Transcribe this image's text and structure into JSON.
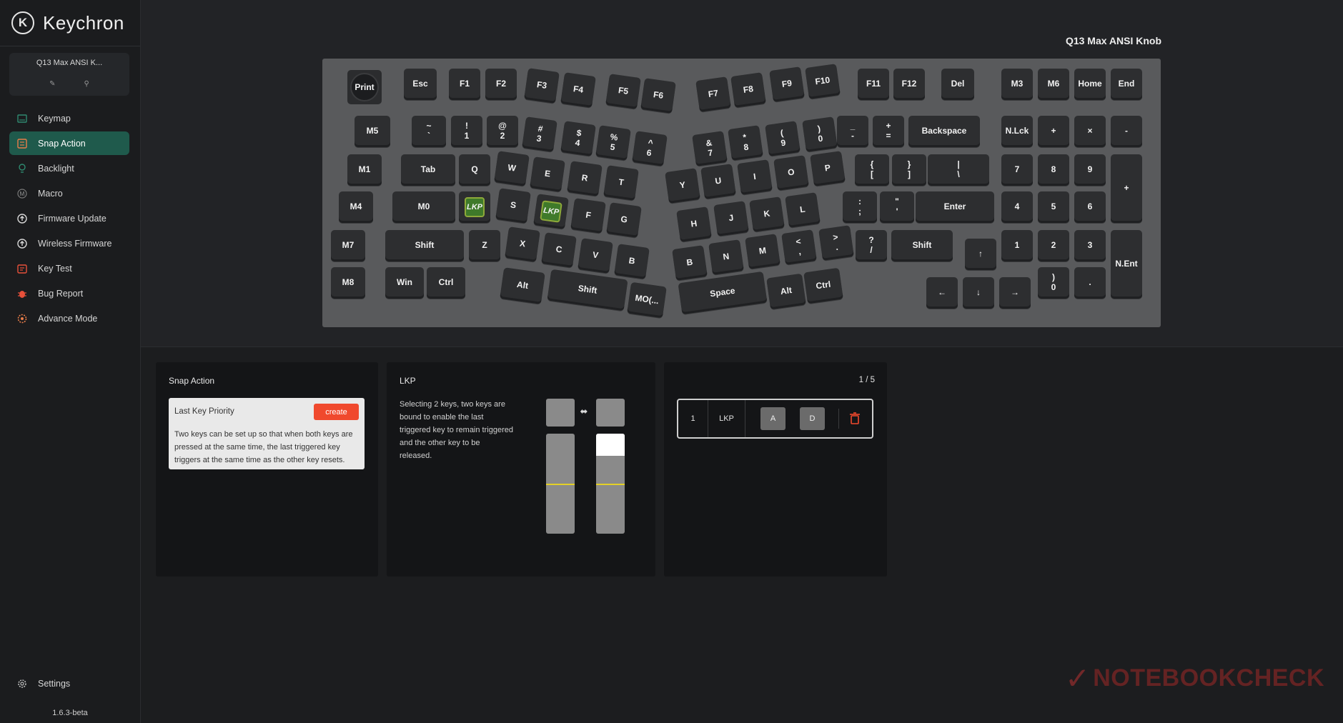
{
  "brand": {
    "logo": "K",
    "name": "Keychron"
  },
  "device": {
    "name": "Q13 Max ANSI K...",
    "full_name": "Q13 Max ANSI Knob"
  },
  "nav": [
    {
      "label": "Keymap",
      "icon": "keymap-icon",
      "active": false
    },
    {
      "label": "Snap Action",
      "icon": "snap-action-icon",
      "active": true
    },
    {
      "label": "Backlight",
      "icon": "backlight-icon",
      "active": false
    },
    {
      "label": "Macro",
      "icon": "macro-icon",
      "active": false
    },
    {
      "label": "Firmware Update",
      "icon": "firmware-update-icon",
      "active": false
    },
    {
      "label": "Wireless Firmware",
      "icon": "wireless-firmware-icon",
      "active": false
    },
    {
      "label": "Key Test",
      "icon": "key-test-icon",
      "active": false
    },
    {
      "label": "Bug Report",
      "icon": "bug-report-icon",
      "active": false
    },
    {
      "label": "Advance Mode",
      "icon": "advance-mode-icon",
      "active": false
    }
  ],
  "settings": {
    "label": "Settings"
  },
  "version": "1.6.3-beta",
  "keyboard": {
    "knob_label": "Print",
    "keys": [
      [
        "Esc",
        "F1",
        "F2",
        "F3",
        "F4",
        "F5",
        "F6",
        "F7",
        "F8",
        "F9",
        "F10",
        "F11",
        "F12",
        "Del",
        "M3",
        "M6",
        "Home",
        "End"
      ],
      [
        "M5",
        "~ `",
        "! 1",
        "@ 2",
        "# 3",
        "$ 4",
        "% 5",
        "^ 6",
        "& 7",
        "* 8",
        "( 9",
        ") 0",
        "_ -",
        "+ =",
        "Backspace",
        "N.Lck",
        "+",
        "×",
        "-"
      ],
      [
        "M1",
        "Tab",
        "Q",
        "W",
        "E",
        "R",
        "T",
        "Y",
        "U",
        "I",
        "O",
        "P",
        "{ [",
        "} ]",
        "| \\",
        "7",
        "8",
        "9",
        "+"
      ],
      [
        "M4",
        "M0",
        "LKP",
        "S",
        "LKP",
        "F",
        "G",
        "H",
        "J",
        "K",
        "L",
        ": ;",
        "\" '",
        "Enter",
        "4",
        "5",
        "6"
      ],
      [
        "M7",
        "Shift",
        "Z",
        "X",
        "C",
        "V",
        "B",
        "B",
        "N",
        "M",
        "< ,",
        "> .",
        "? /",
        "Shift",
        "↑",
        "1",
        "2",
        "3",
        "N.Ent"
      ],
      [
        "M8",
        "Win",
        "Ctrl",
        "Alt",
        "Shift",
        "MO(...",
        "Space",
        "Alt",
        "Ctrl",
        "←",
        "↓",
        "→",
        ") 0",
        "."
      ]
    ]
  },
  "snap_action_panel": {
    "title": "Snap Action",
    "card_title": "Last Key Priority",
    "create_label": "create",
    "description": "Two keys can be set up so that when both keys are pressed at the same time, the last triggered key triggers at the same time as the other key resets."
  },
  "lkp_panel": {
    "title": "LKP",
    "description": "Selecting 2 keys, two keys are bound to enable the last triggered key to remain triggered and the other key to be released.",
    "left_bar": {
      "pressed_fraction": 0.0,
      "actuation_fraction": 0.5
    },
    "right_bar": {
      "pressed_fraction": 0.22,
      "actuation_fraction": 0.5
    }
  },
  "list_panel": {
    "page": "1 / 5",
    "entry": {
      "index": "1",
      "type": "LKP",
      "key_a": "A",
      "key_b": "D"
    }
  },
  "watermark": "NOTEBOOKCHECK",
  "colors": {
    "accent": "#1f5a4c",
    "create": "#f0492d",
    "actuation_line": "#e3d027",
    "lkp_key": "#3f7a2a"
  }
}
